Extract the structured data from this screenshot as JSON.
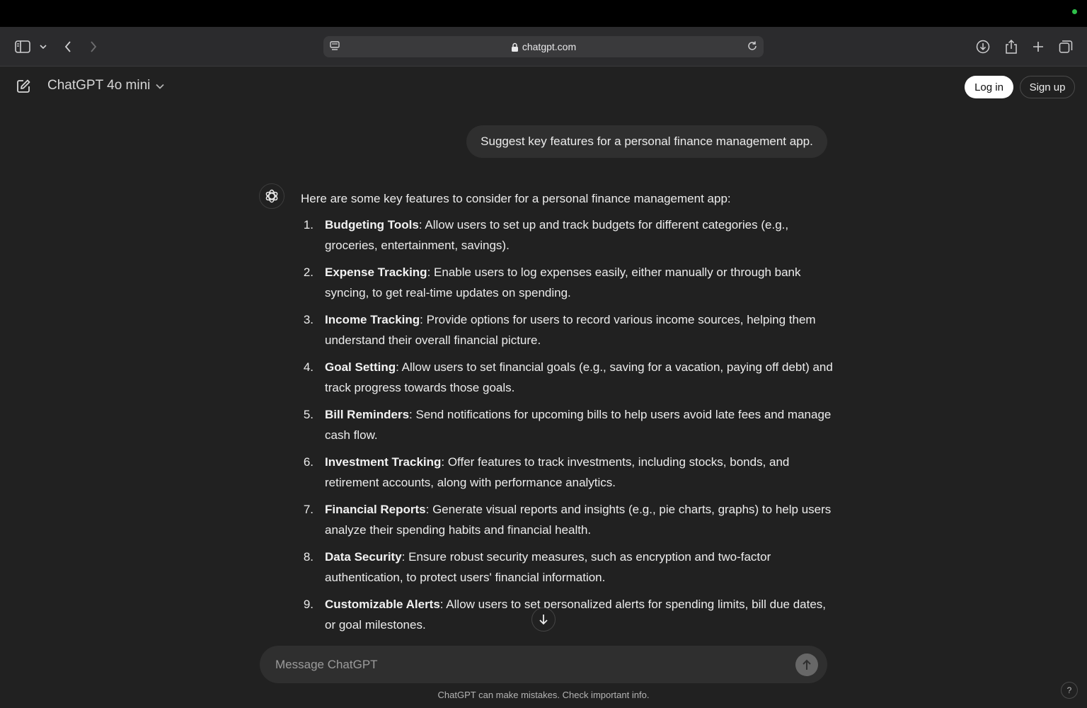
{
  "browser": {
    "url": "chatgpt.com"
  },
  "header": {
    "model_label": "ChatGPT 4o mini",
    "login_label": "Log in",
    "signup_label": "Sign up"
  },
  "conversation": {
    "user_message": "Suggest key features for a personal finance management app.",
    "assistant_intro": "Here are some key features to consider for a personal finance management app:",
    "items": [
      {
        "num": "1.",
        "title": "Budgeting Tools",
        "text": ": Allow users to set up and track budgets for different categories (e.g., groceries, entertainment, savings)."
      },
      {
        "num": "2.",
        "title": "Expense Tracking",
        "text": ": Enable users to log expenses easily, either manually or through bank syncing, to get real-time updates on spending."
      },
      {
        "num": "3.",
        "title": "Income Tracking",
        "text": ": Provide options for users to record various income sources, helping them understand their overall financial picture."
      },
      {
        "num": "4.",
        "title": "Goal Setting",
        "text": ": Allow users to set financial goals (e.g., saving for a vacation, paying off debt) and track progress towards those goals."
      },
      {
        "num": "5.",
        "title": "Bill Reminders",
        "text": ": Send notifications for upcoming bills to help users avoid late fees and manage cash flow."
      },
      {
        "num": "6.",
        "title": "Investment Tracking",
        "text": ": Offer features to track investments, including stocks, bonds, and retirement accounts, along with performance analytics."
      },
      {
        "num": "7.",
        "title": "Financial Reports",
        "text": ": Generate visual reports and insights (e.g., pie charts, graphs) to help users analyze their spending habits and financial health."
      },
      {
        "num": "8.",
        "title": "Data Security",
        "text": ": Ensure robust security measures, such as encryption and two-factor authentication, to protect users' financial information."
      },
      {
        "num": "9.",
        "title": "Customizable Alerts",
        "text": ": Allow users to set personalized alerts for spending limits, bill due dates, or goal milestones."
      }
    ]
  },
  "composer": {
    "placeholder": "Message ChatGPT"
  },
  "footer": {
    "disclaimer": "ChatGPT can make mistakes. Check important info.",
    "help_label": "?"
  },
  "colors": {
    "background": "#212121",
    "bubble": "#2f2f2f",
    "status_dot": "#2fbf4a"
  }
}
